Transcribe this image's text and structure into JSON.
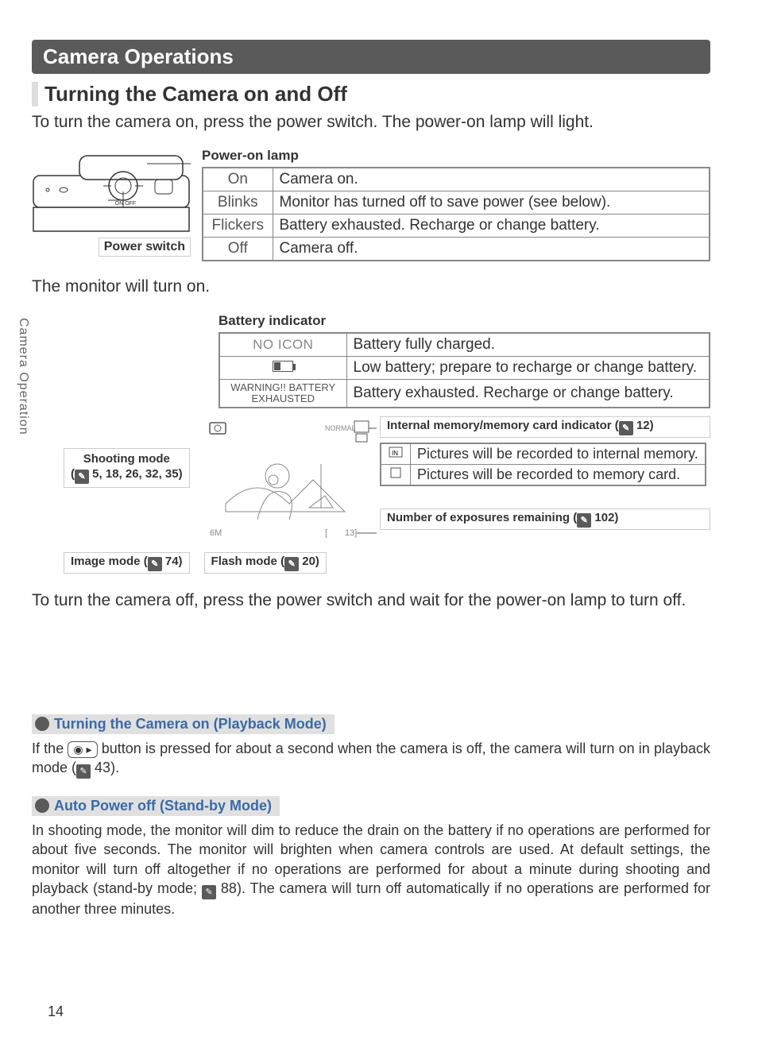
{
  "section_title": "Camera Operations",
  "subheading": "Turning the Camera on and Off",
  "intro_text": "To turn the camera on, press the power switch.  The power-on lamp will light.",
  "power_switch_label": "Power switch",
  "power_on_lamp": {
    "title": "Power-on lamp",
    "rows": [
      {
        "state": "On",
        "desc": "Camera on."
      },
      {
        "state": "Blinks",
        "desc": "Monitor has turned off to save power (see below)."
      },
      {
        "state": "Flickers",
        "desc": "Battery exhausted.  Recharge or change battery."
      },
      {
        "state": "Off",
        "desc": "Camera off."
      }
    ]
  },
  "monitor_text": "The monitor will turn on.",
  "side_tab": "Camera Operation",
  "battery": {
    "title": "Battery indicator",
    "rows": [
      {
        "icon": "NO ICON",
        "desc": "Battery fully charged."
      },
      {
        "icon": "low",
        "desc": "Low battery; prepare to recharge or change battery."
      },
      {
        "icon": "WARNING!! BATTERY EXHAUSTED",
        "desc": "Battery exhausted.  Recharge or change battery."
      }
    ]
  },
  "shooting_mode": {
    "label": "Shooting mode",
    "refs": "5, 18, 26, 32, 35"
  },
  "mem_indicator": {
    "title": "Internal memory/memory card indicator (",
    "ref": "12",
    "rows": [
      {
        "desc": "Pictures will be recorded to internal memory."
      },
      {
        "desc": "Pictures will be recorded to memory card."
      }
    ]
  },
  "exposures": {
    "title": "Number of exposures remaining (",
    "ref": "102"
  },
  "image_mode": {
    "label": "Image mode (",
    "ref": "74"
  },
  "flash_mode": {
    "label": "Flash mode (",
    "ref": "20"
  },
  "turn_off_text": "To turn the camera off, press the power switch and wait for the power-on lamp to turn off.",
  "tip1": {
    "title": "Turning the Camera on (Playback Mode)",
    "text_before": "If the ",
    "text_mid": " button is pressed for about a second when the camera is off, the camera will turn on in playback mode (",
    "ref": "43",
    "text_after": ")."
  },
  "tip2": {
    "title": "Auto Power off (Stand-by Mode)",
    "text_before": "In shooting mode,  the monitor will dim to reduce the drain on the battery if no operations are performed for about five seconds.  The monitor will brighten when camera controls are used.  At default settings, the monitor will turn off altogether if no operations are performed for about a minute during shooting and playback (stand-by mode; ",
    "ref": "88",
    "text_after": ").  The camera will turn off automatically if no operations are performed for another three minutes."
  },
  "page_number": "14"
}
